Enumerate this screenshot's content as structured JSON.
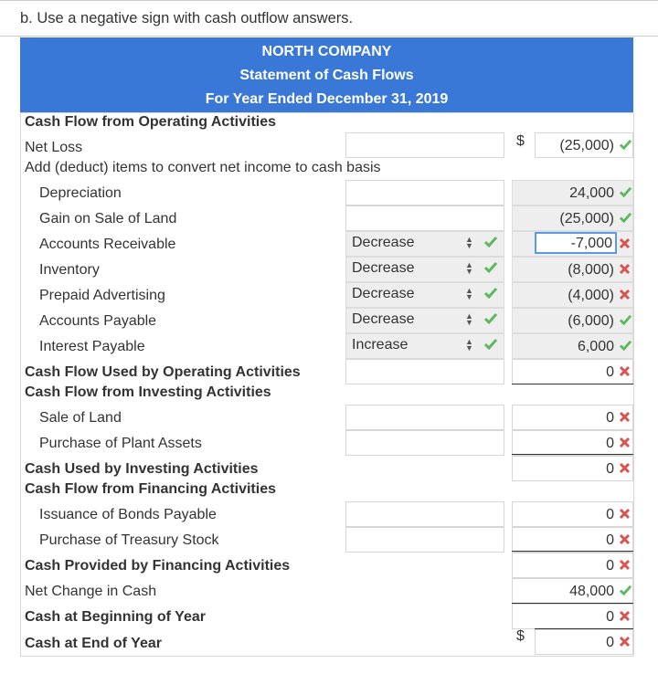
{
  "instruction": "b. Use a negative sign with cash outflow answers.",
  "header": {
    "company": "NORTH COMPANY",
    "statement": "Statement of Cash Flows",
    "period": "For Year Ended December 31, 2019"
  },
  "colors": {
    "header_bg": "#3a78d8",
    "check": "#5cb85c",
    "cross": "#d9534f"
  },
  "rows": {
    "op_title": "Cash Flow from Operating Activities",
    "net_loss": {
      "label": "Net Loss",
      "dollar": "$",
      "value": "(25,000)",
      "status": "correct"
    },
    "adjust_title": "Add (deduct) items to convert net income to cash basis",
    "depreciation": {
      "label": "Depreciation",
      "value": "24,000",
      "status": "correct"
    },
    "gain_land": {
      "label": "Gain on Sale of Land",
      "value": "(25,000)",
      "status": "correct"
    },
    "ar": {
      "label": "Accounts Receivable",
      "select": "Decrease",
      "select_status": "correct",
      "value": "-7,000",
      "status": "incorrect"
    },
    "inventory": {
      "label": "Inventory",
      "select": "Decrease",
      "select_status": "correct",
      "value": "(8,000)",
      "status": "incorrect"
    },
    "prepaid": {
      "label": "Prepaid Advertising",
      "select": "Decrease",
      "select_status": "correct",
      "value": "(4,000)",
      "status": "incorrect"
    },
    "ap": {
      "label": "Accounts Payable",
      "select": "Decrease",
      "select_status": "correct",
      "value": "(6,000)",
      "status": "correct"
    },
    "interest": {
      "label": "Interest Payable",
      "select": "Increase",
      "select_status": "correct",
      "value": "6,000",
      "status": "correct"
    },
    "op_total": {
      "label": "Cash Flow Used by Operating Activities",
      "value": "0",
      "status": "incorrect"
    },
    "inv_title": "Cash Flow from Investing Activities",
    "sale_land": {
      "label": "Sale of Land",
      "value": "0",
      "status": "incorrect"
    },
    "purchase_plant": {
      "label": "Purchase of Plant Assets",
      "value": "0",
      "status": "incorrect"
    },
    "inv_total": {
      "label": "Cash Used by Investing Activities",
      "value": "0",
      "status": "incorrect"
    },
    "fin_title": "Cash Flow from Financing Activities",
    "bonds": {
      "label": "Issuance of Bonds Payable",
      "value": "0",
      "status": "incorrect"
    },
    "treasury": {
      "label": "Purchase of Treasury Stock",
      "value": "0",
      "status": "incorrect"
    },
    "fin_total": {
      "label": "Cash Provided by Financing Activities",
      "value": "0",
      "status": "incorrect"
    },
    "net_change": {
      "label": "Net Change in Cash",
      "value": "48,000",
      "status": "correct"
    },
    "cash_begin": {
      "label": "Cash at Beginning of Year",
      "value": "0",
      "status": "incorrect"
    },
    "cash_end": {
      "label": "Cash at End of Year",
      "dollar": "$",
      "value": "0",
      "status": "incorrect"
    }
  }
}
